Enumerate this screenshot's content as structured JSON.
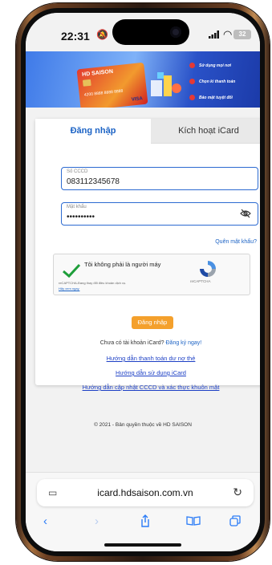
{
  "status_bar": {
    "time": "22:31",
    "battery": "32"
  },
  "banner": {
    "card_brand": "HD SAISON",
    "card_number": "4200 8888 8888 8888",
    "card_network": "VISA",
    "features": [
      "Sử dụng mọi nơi",
      "Chọn kì thanh toán",
      "Bảo mật tuyệt đối"
    ]
  },
  "tabs": {
    "login": "Đăng nhập",
    "activate": "Kích hoạt iCard"
  },
  "form": {
    "cccd_label": "Số CCCD",
    "cccd_value": "083112345678",
    "password_label": "Mật khẩu",
    "password_value": "••••••••••",
    "forgot_password": "Quên mật khẩu?",
    "submit": "Đăng nhập"
  },
  "captcha": {
    "text": "Tôi không phải là người máy",
    "fine_print": "reCAPTCHA-Đang thay đổi điều khoản dịch vụ.",
    "learn_more": "Hãy xem ngay.",
    "brand": "reCAPTCHA"
  },
  "register": {
    "question": "Chưa có tài khoản iCard?",
    "link": "Đăng ký ngay!"
  },
  "help_links": [
    "Hướng dẫn thanh toán dư nợ thẻ",
    "Hướng dẫn sử dụng iCard",
    "Hướng dẫn cập nhật CCCD và xác thực khuôn mặt"
  ],
  "footer": {
    "copyright": "© 2021 - Bản quyền thuộc về HD SAISON"
  },
  "browser": {
    "url": "icard.hdsaison.com.vn"
  }
}
